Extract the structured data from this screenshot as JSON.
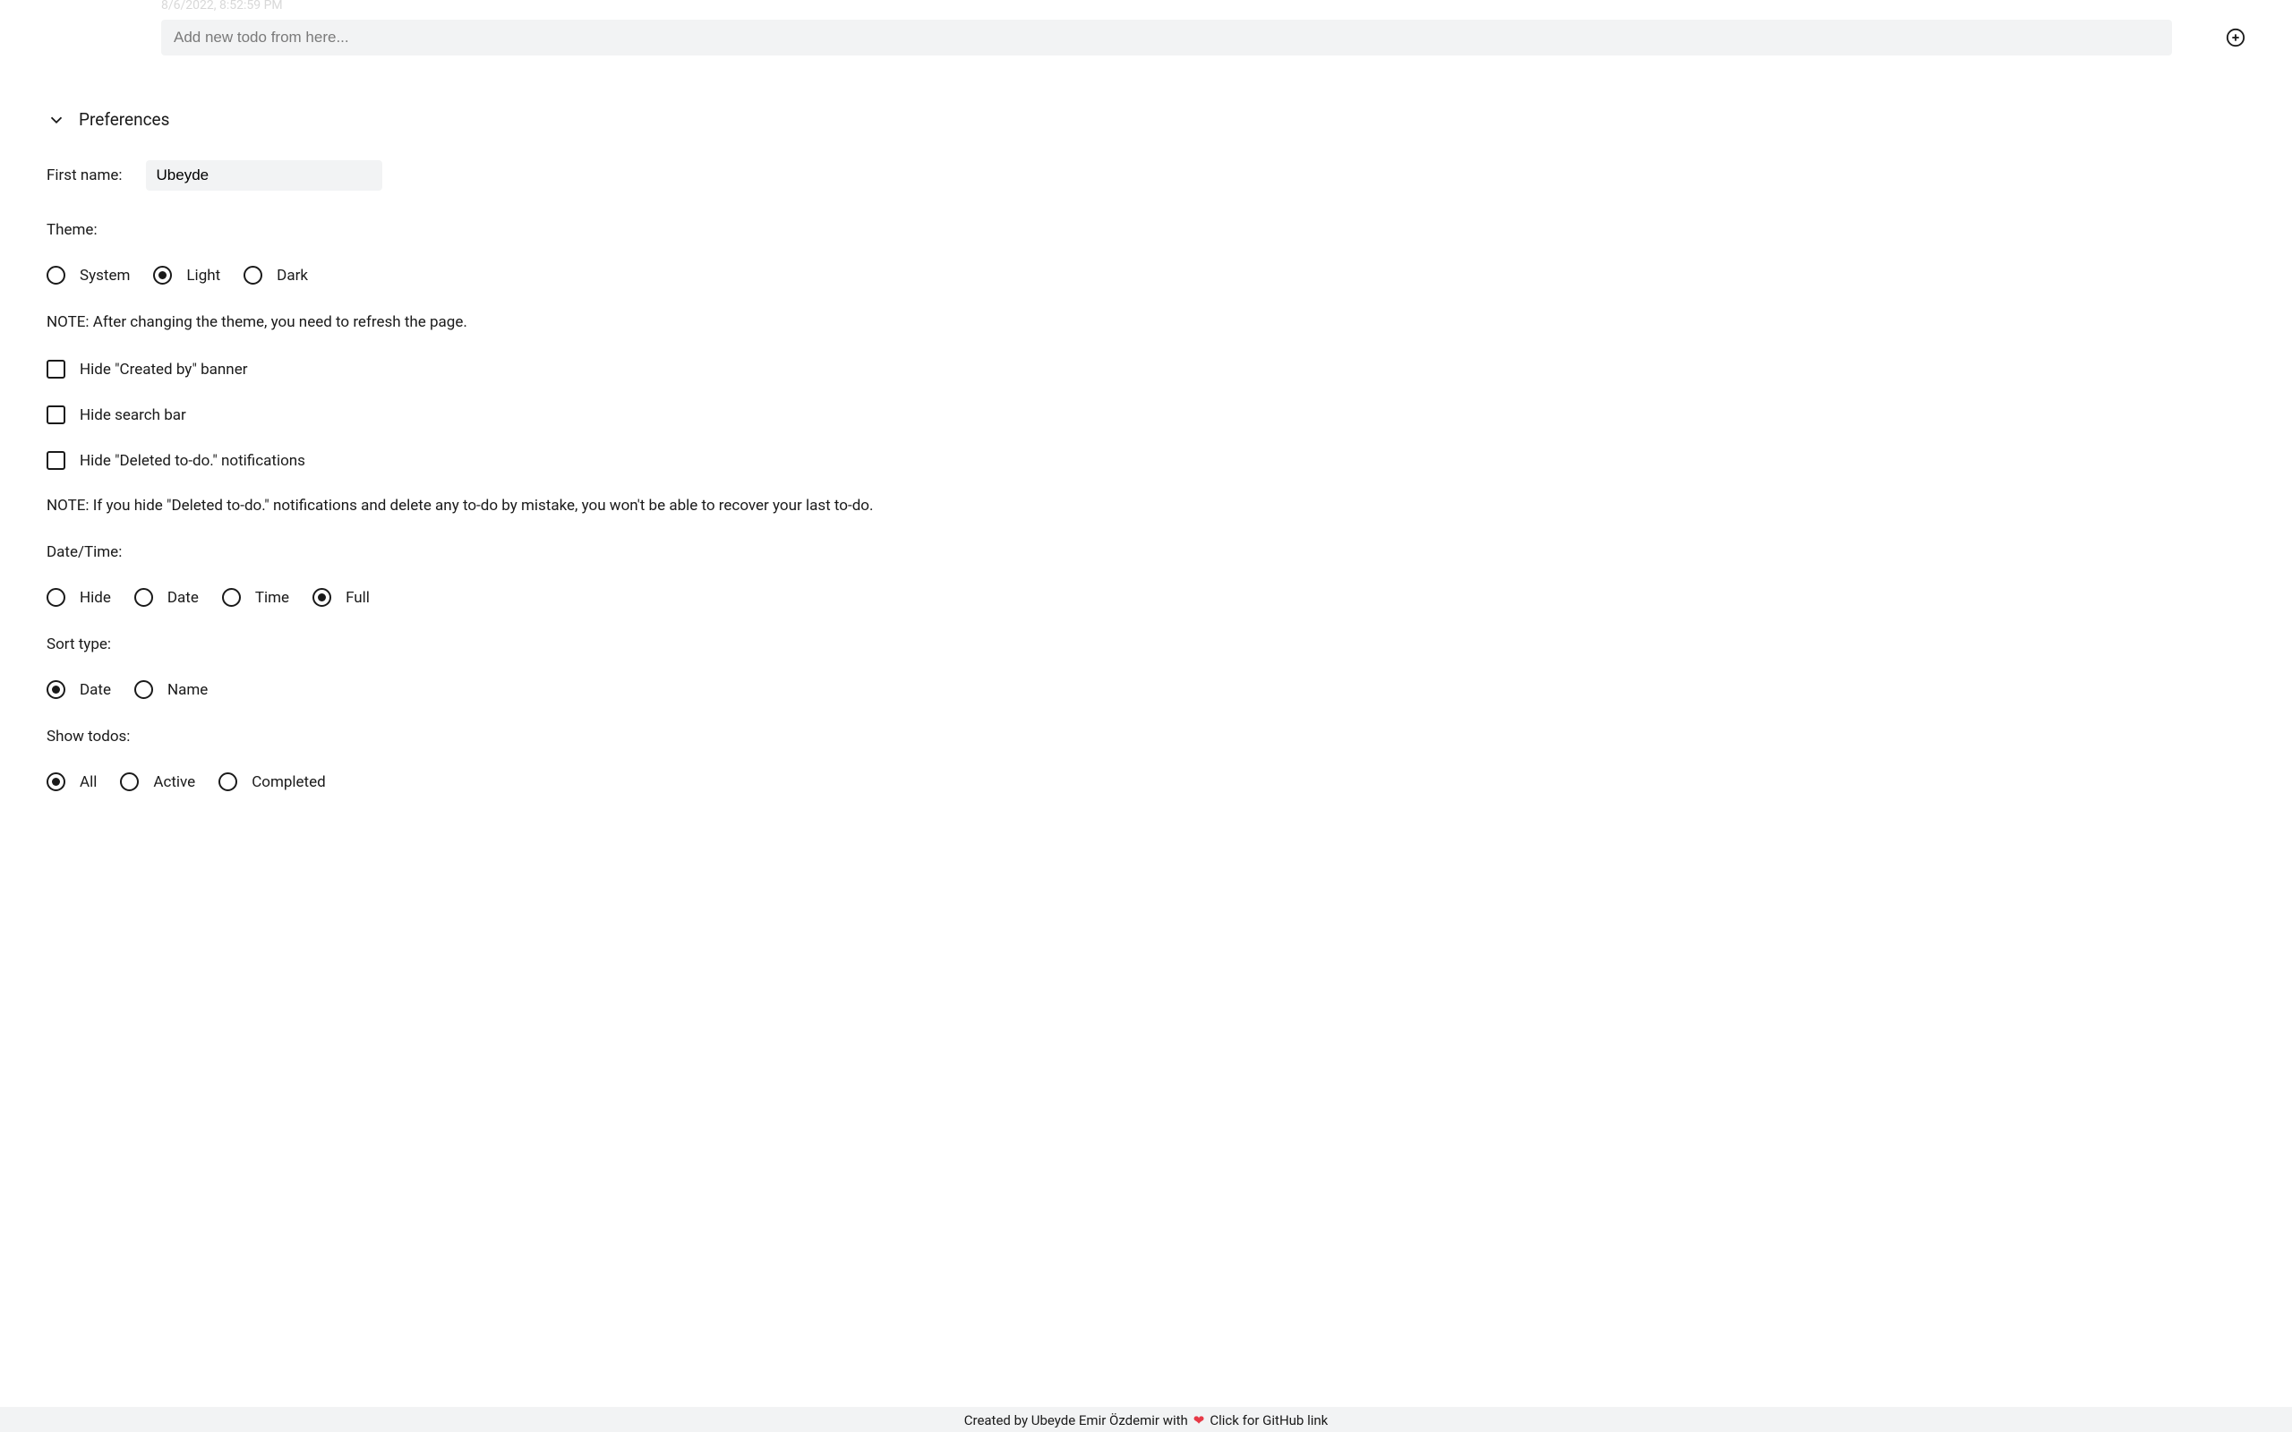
{
  "timestamp": "8/6/2022, 8:52:59 PM",
  "todo_input": {
    "placeholder": "Add new todo from here..."
  },
  "preferences": {
    "title": "Preferences",
    "first_name": {
      "label": "First name:",
      "value": "Ubeyde"
    },
    "theme": {
      "label": "Theme:",
      "options": [
        "System",
        "Light",
        "Dark"
      ],
      "selected": "Light",
      "note": "NOTE: After changing the theme, you need to refresh the page."
    },
    "checkboxes": {
      "hide_created_by": "Hide \"Created by\" banner",
      "hide_search_bar": "Hide search bar",
      "hide_deleted_notifications": "Hide \"Deleted to-do.\" notifications",
      "note": "NOTE: If you hide \"Deleted to-do.\" notifications and delete any to-do by mistake, you won't be able to recover your last to-do."
    },
    "date_time": {
      "label": "Date/Time:",
      "options": [
        "Hide",
        "Date",
        "Time",
        "Full"
      ],
      "selected": "Full"
    },
    "sort_type": {
      "label": "Sort type:",
      "options": [
        "Date",
        "Name"
      ],
      "selected": "Date"
    },
    "show_todos": {
      "label": "Show todos:",
      "options": [
        "All",
        "Active",
        "Completed"
      ],
      "selected": "All"
    }
  },
  "footer": {
    "text_before": "Created by Ubeyde Emir Özdemir with",
    "text_after": "Click for GitHub link"
  }
}
